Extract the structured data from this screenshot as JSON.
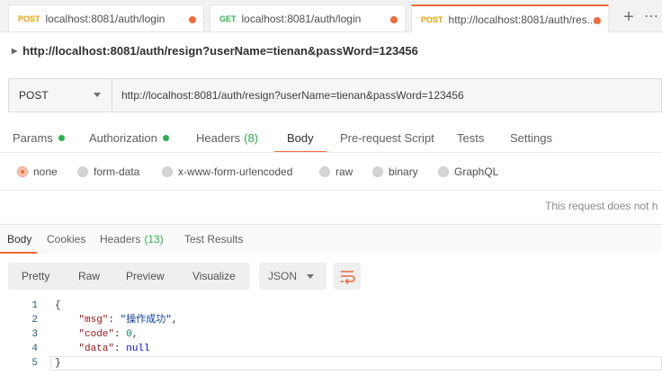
{
  "tabs": [
    {
      "method": "POST",
      "url": "localhost:8081/auth/login",
      "method_color": "#f0a000"
    },
    {
      "method": "GET",
      "url": "localhost:8081/auth/login",
      "method_color": "#2bb24c"
    },
    {
      "method": "POST",
      "url": "http://localhost:8081/auth/res...",
      "method_color": "#f0a000"
    }
  ],
  "tab_add_icon": "+",
  "tab_more_icon": "⋯",
  "title": "http://localhost:8081/auth/resign?userName=tienan&passWord=123456",
  "request": {
    "method": "POST",
    "url": "http://localhost:8081/auth/resign?userName=tienan&passWord=123456"
  },
  "request_tabs": [
    {
      "label": "Params"
    },
    {
      "label": "Authorization"
    },
    {
      "label": "Headers",
      "count": "(8)"
    },
    {
      "label": "Body"
    },
    {
      "label": "Pre-request Script"
    },
    {
      "label": "Tests"
    },
    {
      "label": "Settings"
    }
  ],
  "body_types": [
    "none",
    "form-data",
    "x-www-form-urlencoded",
    "raw",
    "binary",
    "GraphQL"
  ],
  "selected_body_type": "none",
  "no_params_message": "This request does not h",
  "response_tabs": [
    {
      "label": "Body"
    },
    {
      "label": "Cookies"
    },
    {
      "label": "Headers",
      "count": "(13)"
    },
    {
      "label": "Test Results"
    }
  ],
  "view_modes": [
    "Pretty",
    "Raw",
    "Preview",
    "Visualize"
  ],
  "format": "JSON",
  "code": {
    "line_numbers": [
      "1",
      "2",
      "3",
      "4",
      "5"
    ],
    "open_brace": "{",
    "close_brace": "}",
    "msg_key": "\"msg\"",
    "msg_value": "\"操作成功\"",
    "code_key": "\"code\"",
    "code_value": "0",
    "data_key": "\"data\"",
    "data_value": "null"
  },
  "colors": {
    "accent": "#f26b3a",
    "status_green": "#2bb24c"
  }
}
